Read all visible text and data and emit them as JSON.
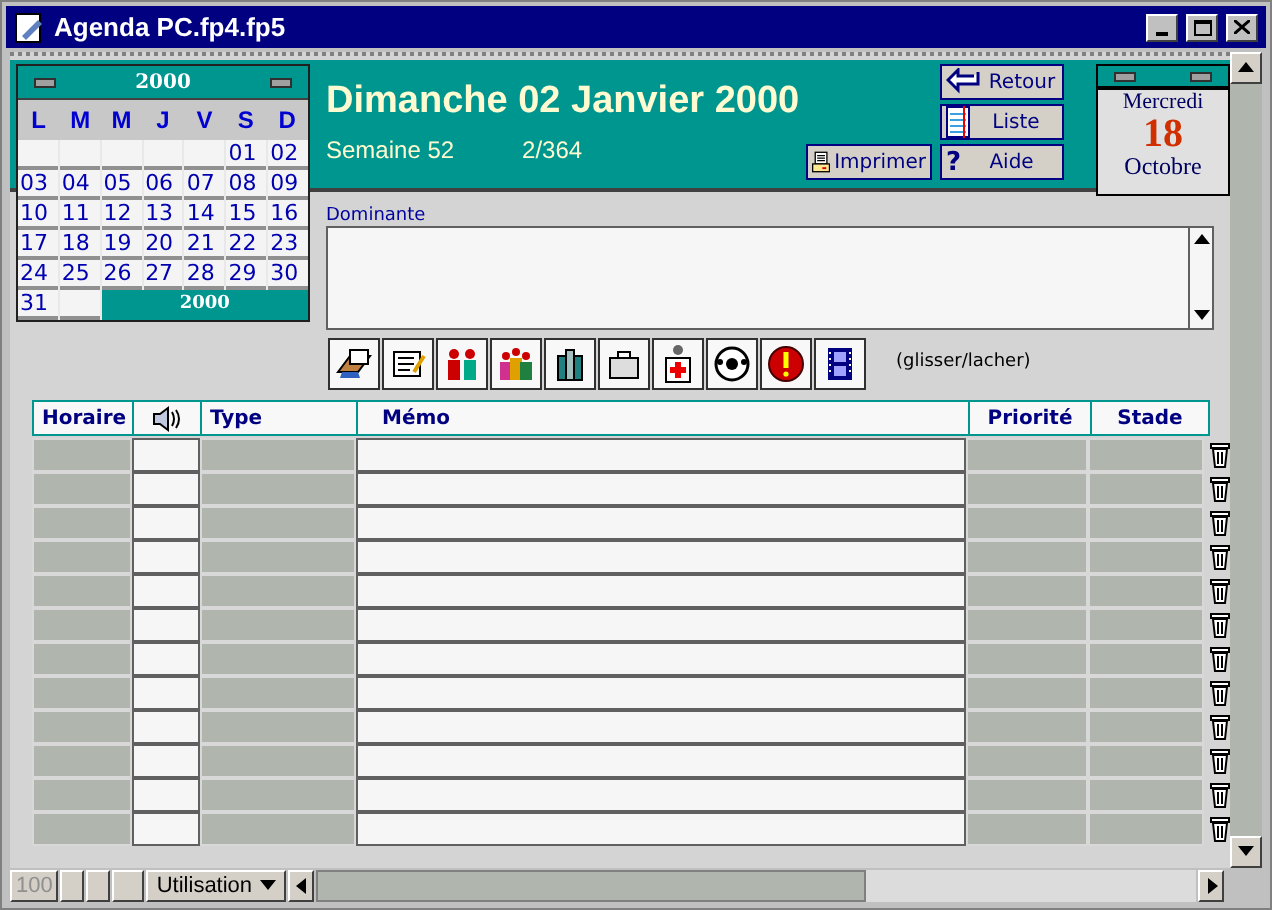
{
  "window": {
    "title": "Agenda PC.fp4.fp5"
  },
  "calendar": {
    "year": "2000",
    "weekdays": [
      "L",
      "M",
      "M",
      "J",
      "V",
      "S",
      "D"
    ],
    "weeks": [
      [
        {
          "kind": "blank"
        },
        {
          "kind": "blank"
        },
        {
          "kind": "blank"
        },
        {
          "kind": "blank"
        },
        {
          "kind": "blank"
        },
        {
          "kind": "day",
          "label": "01"
        },
        {
          "kind": "day",
          "label": "02"
        }
      ],
      [
        {
          "kind": "day",
          "label": "03"
        },
        {
          "kind": "day",
          "label": "04"
        },
        {
          "kind": "day",
          "label": "05"
        },
        {
          "kind": "day",
          "label": "06"
        },
        {
          "kind": "day",
          "label": "07"
        },
        {
          "kind": "day",
          "label": "08"
        },
        {
          "kind": "day",
          "label": "09"
        }
      ],
      [
        {
          "kind": "day",
          "label": "10"
        },
        {
          "kind": "day",
          "label": "11"
        },
        {
          "kind": "day",
          "label": "12"
        },
        {
          "kind": "day",
          "label": "13"
        },
        {
          "kind": "day",
          "label": "14"
        },
        {
          "kind": "day",
          "label": "15"
        },
        {
          "kind": "day",
          "label": "16"
        }
      ],
      [
        {
          "kind": "day",
          "label": "17"
        },
        {
          "kind": "day",
          "label": "18"
        },
        {
          "kind": "day",
          "label": "19"
        },
        {
          "kind": "day",
          "label": "20"
        },
        {
          "kind": "day",
          "label": "21"
        },
        {
          "kind": "day",
          "label": "22"
        },
        {
          "kind": "day",
          "label": "23"
        }
      ],
      [
        {
          "kind": "day",
          "label": "24"
        },
        {
          "kind": "day",
          "label": "25"
        },
        {
          "kind": "day",
          "label": "26"
        },
        {
          "kind": "day",
          "label": "27"
        },
        {
          "kind": "day",
          "label": "28"
        },
        {
          "kind": "day",
          "label": "29"
        },
        {
          "kind": "day",
          "label": "30"
        }
      ],
      [
        {
          "kind": "day",
          "label": "31"
        },
        {
          "kind": "blank"
        }
      ]
    ],
    "footer": "2000"
  },
  "header": {
    "date": "Dimanche 02 Janvier 2000",
    "week": "Semaine 52",
    "day_of_year": "2/364"
  },
  "buttons": [
    {
      "label": "Retour",
      "kind": "back"
    },
    {
      "label": "Liste",
      "kind": "list"
    },
    {
      "label": "Imprimer",
      "kind": "print"
    },
    {
      "label": "Aide",
      "kind": "help",
      "glyph": "?"
    }
  ],
  "today": {
    "weekday": "Mercredi",
    "day": "18",
    "month": "Octobre"
  },
  "dominante": {
    "label": "Dominante"
  },
  "toolbar": {
    "hint": "(glisser/lacher)"
  },
  "table": {
    "columns": [
      {
        "label": "Horaire",
        "kind": "text"
      },
      {
        "kind": "sound"
      },
      {
        "label": "Type",
        "kind": "text"
      },
      {
        "label": "Mémo",
        "kind": "text"
      },
      {
        "label": "Priorité",
        "kind": "text"
      },
      {
        "label": "Stade",
        "kind": "text"
      }
    ]
  },
  "status_bar": {
    "zoom": "100",
    "mode": "Utilisation"
  }
}
